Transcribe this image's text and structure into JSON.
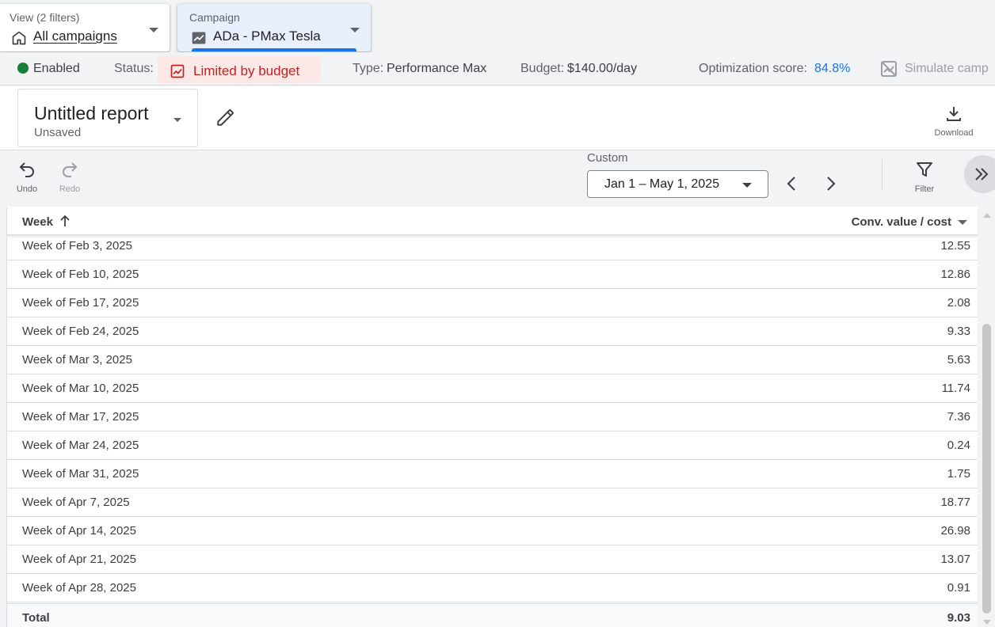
{
  "filters": {
    "view": {
      "label": "View (2 filters)",
      "value": "All campaigns",
      "icon": "home-icon"
    },
    "campaign": {
      "label": "Campaign",
      "value": "ADa - PMax Tesla",
      "icon": "performance-chart-icon"
    }
  },
  "status_bar": {
    "enabled": "Enabled",
    "status_label": "Status:",
    "status_value": "Limited by budget",
    "type_label": "Type:",
    "type_value": "Performance Max",
    "budget_label": "Budget:",
    "budget_value": "$140.00/day",
    "optimization_label": "Optimization score:",
    "optimization_value": "84.8%",
    "simulate": "Simulate camp",
    "colors": {
      "enabled": "#188038",
      "limited": "#c5221f",
      "link": "#1a73e8"
    }
  },
  "report": {
    "title": "Untitled report",
    "subtitle": "Unsaved",
    "download_label": "Download"
  },
  "toolbar": {
    "undo_label": "Undo",
    "redo_label": "Redo",
    "date_range_label": "Custom",
    "date_range_value": "Jan 1 – May 1, 2025",
    "filter_label": "Filter"
  },
  "table": {
    "columns": [
      "Week",
      "Conv. value / cost"
    ],
    "rows": [
      {
        "week": "Week of Feb 3, 2025",
        "value": "12.55"
      },
      {
        "week": "Week of Feb 10, 2025",
        "value": "12.86"
      },
      {
        "week": "Week of Feb 17, 2025",
        "value": "2.08"
      },
      {
        "week": "Week of Feb 24, 2025",
        "value": "9.33"
      },
      {
        "week": "Week of Mar 3, 2025",
        "value": "5.63"
      },
      {
        "week": "Week of Mar 10, 2025",
        "value": "11.74"
      },
      {
        "week": "Week of Mar 17, 2025",
        "value": "7.36"
      },
      {
        "week": "Week of Mar 24, 2025",
        "value": "0.24"
      },
      {
        "week": "Week of Mar 31, 2025",
        "value": "1.75"
      },
      {
        "week": "Week of Apr 7, 2025",
        "value": "18.77"
      },
      {
        "week": "Week of Apr 14, 2025",
        "value": "26.98"
      },
      {
        "week": "Week of Apr 21, 2025",
        "value": "13.07"
      },
      {
        "week": "Week of Apr 28, 2025",
        "value": "0.91"
      }
    ],
    "total_label": "Total",
    "total_value": "9.03"
  }
}
